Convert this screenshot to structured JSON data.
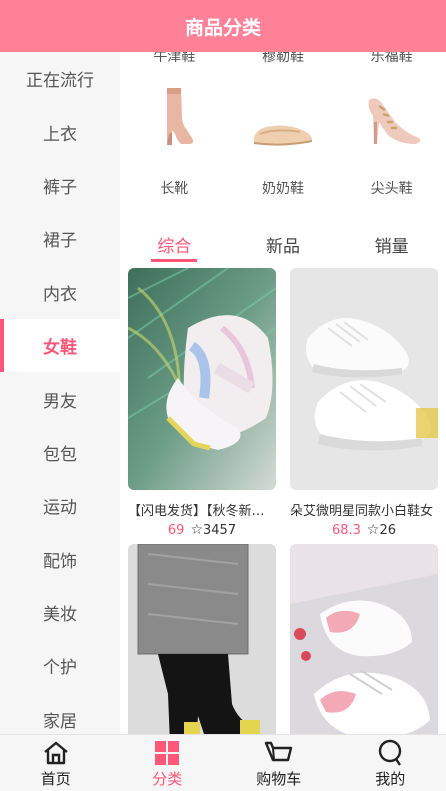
{
  "header": {
    "title": "商品分类"
  },
  "sidebar": {
    "items": [
      {
        "label": "正在流行"
      },
      {
        "label": "上衣"
      },
      {
        "label": "裤子"
      },
      {
        "label": "裙子"
      },
      {
        "label": "内衣"
      },
      {
        "label": "女鞋",
        "active": true
      },
      {
        "label": "男友"
      },
      {
        "label": "包包"
      },
      {
        "label": "运动"
      },
      {
        "label": "配饰"
      },
      {
        "label": "美妆"
      },
      {
        "label": "个护"
      },
      {
        "label": "家居"
      }
    ]
  },
  "subcategories": {
    "top_partial": [
      {
        "label": "牛津鞋"
      },
      {
        "label": "穆勒鞋"
      },
      {
        "label": "乐福鞋"
      }
    ],
    "row": [
      {
        "label": "长靴",
        "icon": "boot-icon"
      },
      {
        "label": "奶奶鞋",
        "icon": "flat-shoe-icon"
      },
      {
        "label": "尖头鞋",
        "icon": "heel-shoe-icon"
      }
    ]
  },
  "tabs": [
    {
      "label": "综合",
      "active": true
    },
    {
      "label": "新品"
    },
    {
      "label": "销量"
    }
  ],
  "products": [
    {
      "title": "【闪电发货】【秋冬新款】",
      "price": "69",
      "sales": "3457"
    },
    {
      "title": "朵艾微明星同款小白鞋女",
      "price": "68.3",
      "sales": "26"
    },
    {
      "title": "",
      "price": "",
      "sales": ""
    },
    {
      "title": "",
      "price": "",
      "sales": ""
    }
  ],
  "tabbar": [
    {
      "label": "首页",
      "icon": "home-icon"
    },
    {
      "label": "分类",
      "icon": "category-icon",
      "active": true
    },
    {
      "label": "购物车",
      "icon": "cart-icon"
    },
    {
      "label": "我的",
      "icon": "profile-icon"
    }
  ],
  "colors": {
    "brand": "#ff8198",
    "accent": "#ff5777"
  }
}
